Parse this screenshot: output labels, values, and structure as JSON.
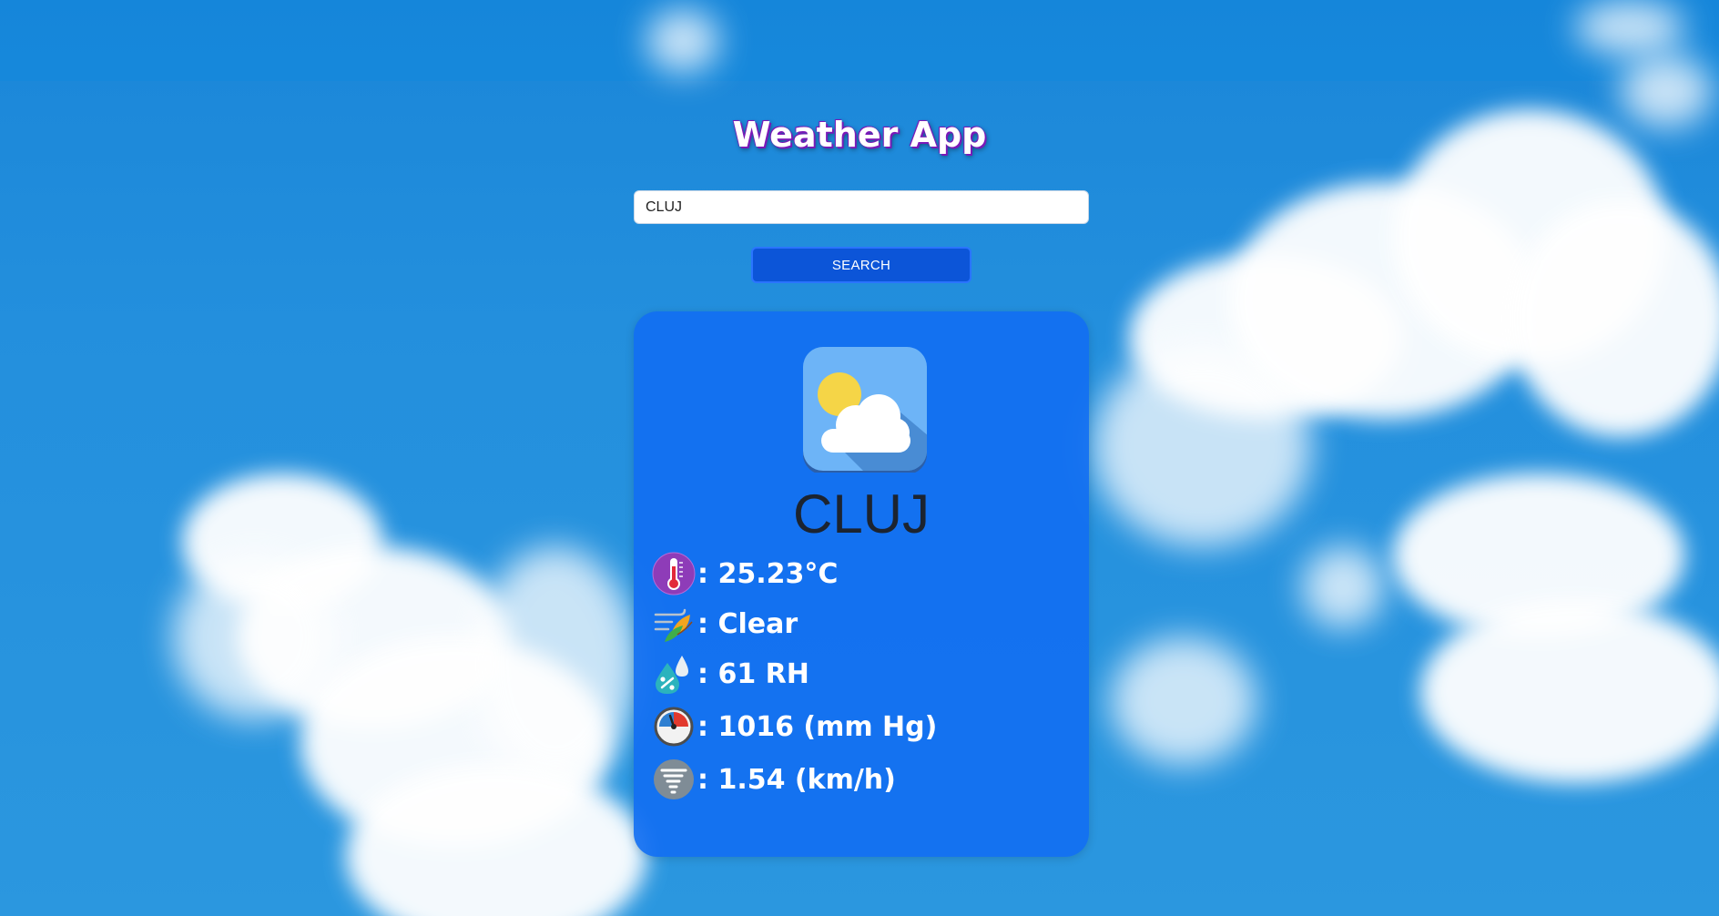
{
  "app": {
    "title": "Weather App"
  },
  "search": {
    "value": "CLUJ",
    "button_label": "SEARCH"
  },
  "weather": {
    "city": "CLUJ",
    "condition_icon": "sun-behind-cloud-icon",
    "rows": [
      {
        "icon": "thermometer-icon",
        "text": ": 25.23°C"
      },
      {
        "icon": "wind-leaves-icon",
        "text": ": Clear"
      },
      {
        "icon": "humidity-drop-icon",
        "text": ": 61 RH"
      },
      {
        "icon": "barometer-icon",
        "text": ": 1016 (mm Hg)"
      },
      {
        "icon": "tornado-wind-icon",
        "text": ": 1.54 (km/h)"
      }
    ]
  },
  "colors": {
    "sky": "#1a86d8",
    "card": "#1270f2",
    "button": "#0c55d8",
    "title_outline": "#7a1ab8",
    "city_text": "#1c2430"
  }
}
